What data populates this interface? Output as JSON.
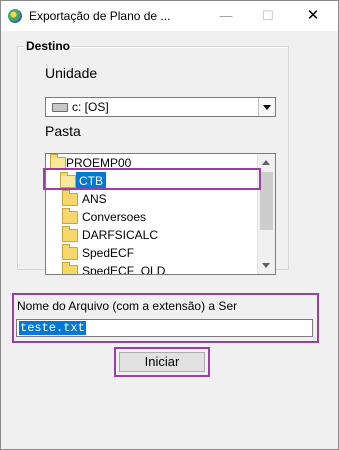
{
  "window": {
    "title": "Exportação de Plano de ...",
    "minimize_label": "—",
    "maximize_label": "☐",
    "close_label": "✕"
  },
  "group": {
    "title": "Destino"
  },
  "unit": {
    "label": "Unidade",
    "value": "c: [OS]"
  },
  "folder": {
    "label": "Pasta",
    "items": [
      {
        "name": "PROEMP00"
      },
      {
        "name": "CTB"
      },
      {
        "name": "ANS"
      },
      {
        "name": "Conversoes"
      },
      {
        "name": "DARFSICALC"
      },
      {
        "name": "SpedECF"
      },
      {
        "name": "SpedECF_OLD"
      }
    ],
    "selected": "CTB"
  },
  "file": {
    "label": "Nome do Arquivo (com a extensão) a Ser",
    "value": "teste.txt"
  },
  "action": {
    "start_label": "Iniciar"
  },
  "colors": {
    "highlight_border": "#9b3fa5",
    "selection": "#0078d7",
    "background": "#f0f0f0"
  }
}
